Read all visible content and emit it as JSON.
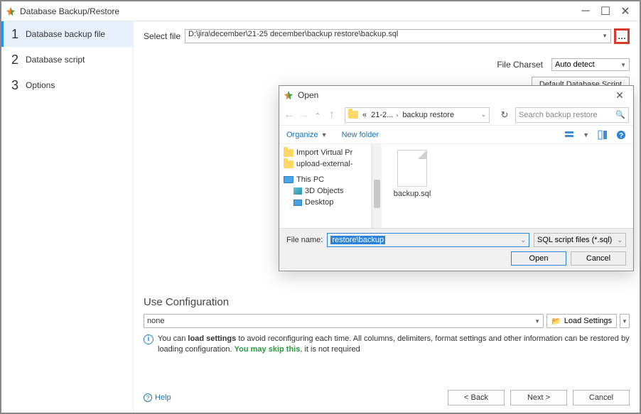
{
  "window": {
    "title": "Database Backup/Restore"
  },
  "steps": [
    {
      "num": "1",
      "label": "Database backup file"
    },
    {
      "num": "2",
      "label": "Database script"
    },
    {
      "num": "3",
      "label": "Options"
    }
  ],
  "selectfile": {
    "label": "Select file",
    "value": "D:\\jira\\december\\21-25 december\\backup restore\\backup.sql"
  },
  "charset": {
    "label": "File Charset",
    "value": "Auto detect"
  },
  "buttons": {
    "default_script": "Default Database Script",
    "back": "< Back",
    "next": "Next >",
    "cancel": "Cancel",
    "help": "Help",
    "load_settings": "Load Settings"
  },
  "config": {
    "heading": "Use Configuration",
    "value": "none",
    "info_pre": "You can ",
    "info_b1": "load settings",
    "info_mid": " to avoid reconfiguring each time. All columns, delimiters, format settings and other information can be restored by loading configuration. ",
    "info_green": "You may skip this",
    "info_post": ", it is not required"
  },
  "opendlg": {
    "title": "Open",
    "path_seg1": "21-2...",
    "path_seg2": "backup restore",
    "search_placeholder": "Search backup restore",
    "organize": "Organize",
    "newfolder": "New folder",
    "tree": {
      "importvp": "Import Virtual Pr",
      "upload": "upload-external-",
      "thispc": "This PC",
      "threed": "3D Objects",
      "desktop": "Desktop"
    },
    "file": "backup.sql",
    "filename_label": "File name:",
    "filename_value": "restore\\backup",
    "filter": "SQL script files (*.sql)",
    "open": "Open",
    "cancel": "Cancel"
  }
}
